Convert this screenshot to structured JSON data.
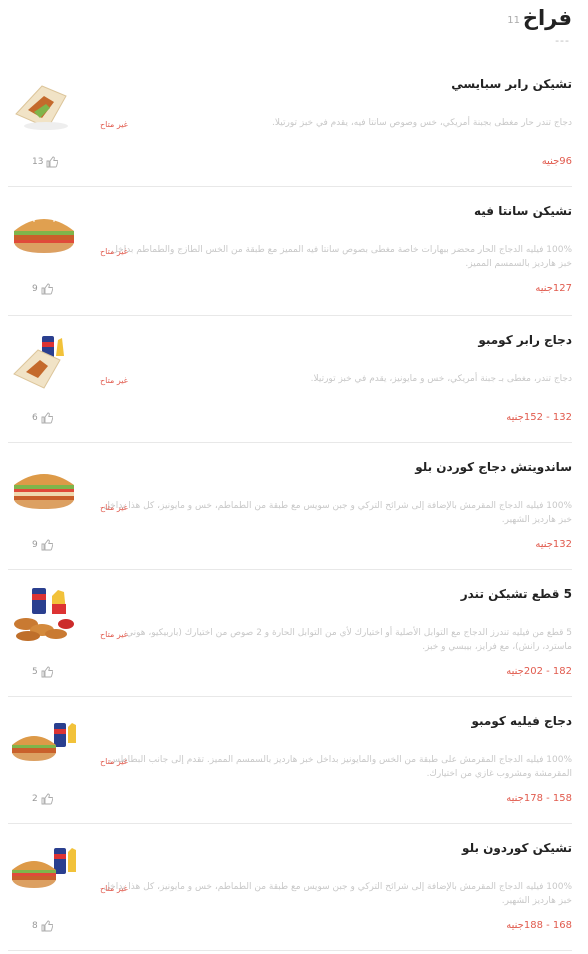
{
  "category": {
    "title": "فراخ",
    "count": "11",
    "dash": "---"
  },
  "colors": {
    "accent": "#e15b4e",
    "muted_text": "#c8c8c8",
    "divider": "#e8e8e8"
  },
  "icons": {
    "like": "thumbs-up-icon"
  },
  "items": [
    {
      "name": "تشيكن رابر سبايسي",
      "description": "دجاج تندر حار مغطى بجبنة أمريكي، خس وصوص سانتا فيه، يقدم في خبز تورتيلا.",
      "status": "غير متاح",
      "price": "96جنيه",
      "likes": "13"
    },
    {
      "name": "تشيكن سانتا فيه",
      "description": "100% فيليه الدجاج الحار محضر ببهارات خاصة مغطى بصوص سانتا فيه المميز مع طبقة من الخس الطازج والطماطم بداخل خبز هارديز بالسمسم المميز.",
      "status": "غير متاح",
      "price": "127جنيه",
      "likes": "9"
    },
    {
      "name": "دجاج رابر كومبو",
      "description": "دجاج تندر، مغطى بـ جبنة أمريكي، خس و مايونيز، يقدم في خبز تورتيلا.",
      "status": "غير متاح",
      "price": "132 - 152جنيه",
      "likes": "6"
    },
    {
      "name": "ساندويتش دجاج كوردن بلو",
      "description": "100% فيليه الدجاج المقرمش بالإضافة إلى شرائح التركي و جبن سويس مع طبقة من الطماطم، خس و مايونيز، كل هذا بداخل خبز هارديز الشهير.",
      "status": "غير متاح",
      "price": "132جنيه",
      "likes": "9"
    },
    {
      "name": "5 قطع تشيكن تندر",
      "description": "5 قطع من فيليه تندرز الدجاج مع التوابل الأصلية أو اختيارك لأي من التوابل الحارة و 2 صوص من اختيارك (باربيكيو، هوني ماسترد، رانش)، مع فرايز، بيبسي و خبز.",
      "status": "غير متاح",
      "price": "182 - 202جنيه",
      "likes": "5"
    },
    {
      "name": "دجاج فيليه كومبو",
      "description": "100% فيليه الدجاج المقرمش على طبقة من الخس والمايونيز بداخل خبز هارديز بالسمسم المميز. تقدم إلى جانب البطاطس المقرمشة ومشروب غازي من اختيارك.",
      "status": "غير متاح",
      "price": "158 - 178جنيه",
      "likes": "2"
    },
    {
      "name": "تشيكن كوردون بلو",
      "description": "100% فيليه الدجاج المقرمش بالإضافة إلى شرائح التركي و جبن سويس مع طبقة من الطماطم، خس و مايونيز، كل هذا بداخل خبز هارديز الشهير.",
      "status": "غير متاح",
      "price": "168 - 188جنيه",
      "likes": "8"
    }
  ]
}
